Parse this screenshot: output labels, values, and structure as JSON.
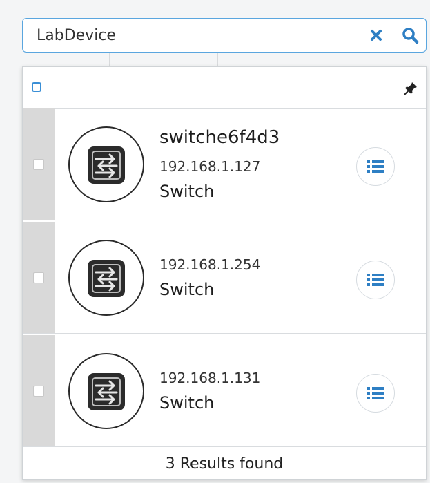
{
  "search": {
    "value": "LabDevice",
    "clear_icon": "close-icon",
    "search_icon": "search-icon"
  },
  "panel": {
    "pin_icon": "pin-icon"
  },
  "devices": [
    {
      "name": "switche6f4d3",
      "ip": "192.168.1.127",
      "type": "Switch",
      "icon": "network-switch-icon"
    },
    {
      "name": "",
      "ip": "192.168.1.254",
      "type": "Switch",
      "icon": "network-switch-icon"
    },
    {
      "name": "",
      "ip": "192.168.1.131",
      "type": "Switch",
      "icon": "network-switch-icon"
    }
  ],
  "results": {
    "label": "3 Results found"
  },
  "colors": {
    "accent": "#3a8fd6",
    "icon_dark": "#2b2b2b",
    "gutter": "#d9d9d9"
  }
}
